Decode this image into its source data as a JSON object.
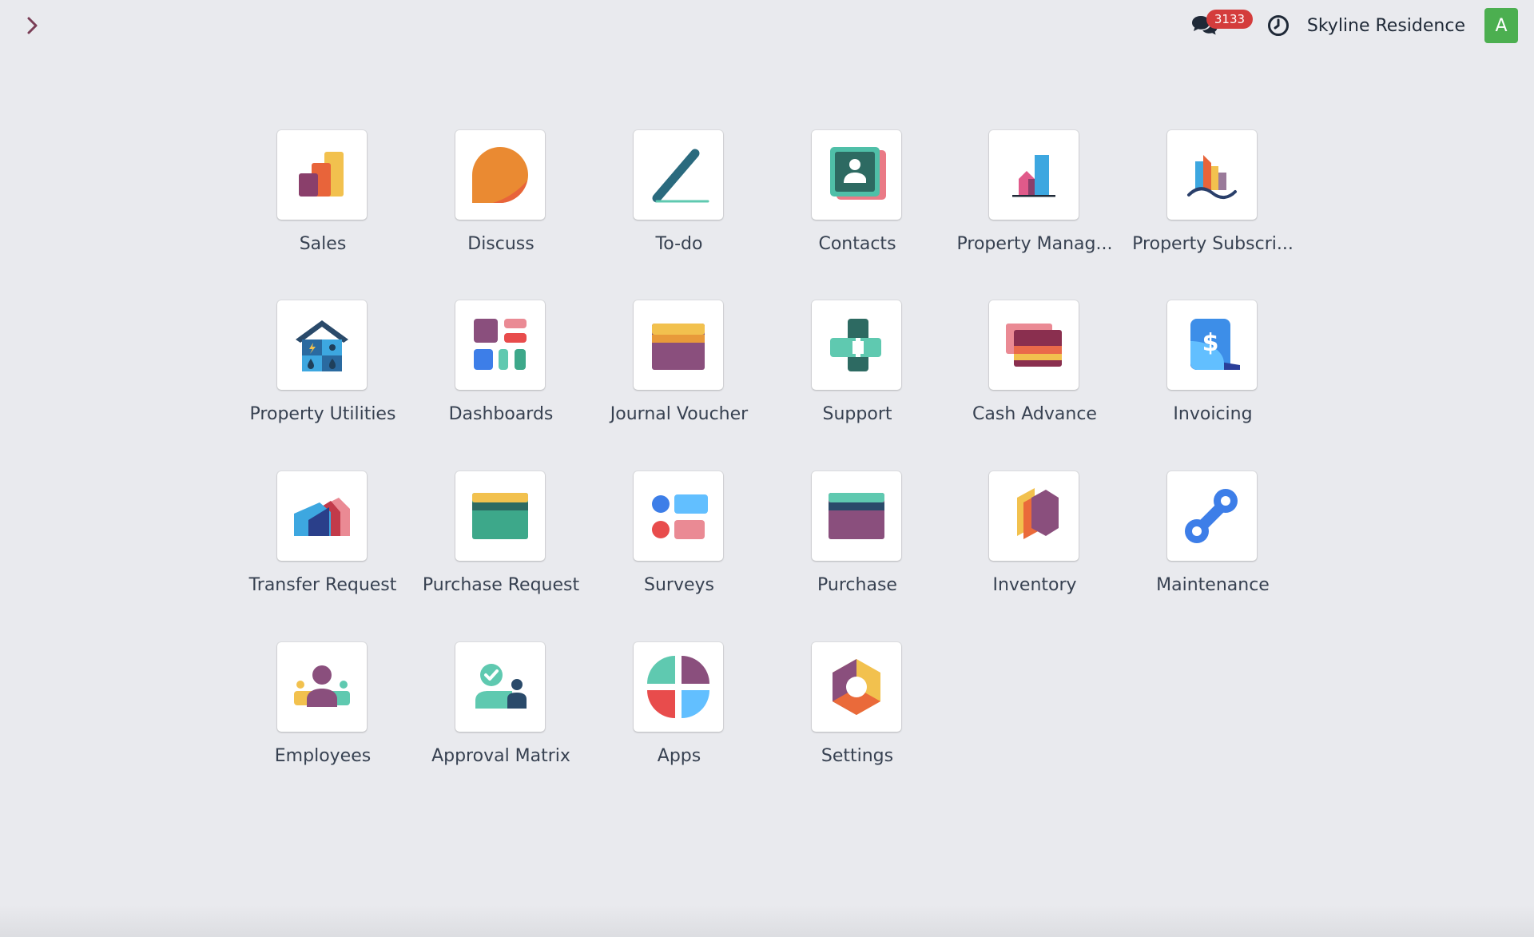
{
  "topbar": {
    "chat_count": "3133",
    "company": "Skyline Residence",
    "avatar_letter": "A"
  },
  "colors": {
    "background": "#e9eaee",
    "badge": "#d43c3c",
    "avatar": "#4caf50",
    "toggle": "#7a3e56"
  },
  "apps": [
    {
      "label": "Sales",
      "icon": "sales-icon"
    },
    {
      "label": "Discuss",
      "icon": "discuss-icon"
    },
    {
      "label": "To-do",
      "icon": "todo-icon"
    },
    {
      "label": "Contacts",
      "icon": "contacts-icon"
    },
    {
      "label": "Property Manag...",
      "icon": "property-management-icon"
    },
    {
      "label": "Property Subscri...",
      "icon": "property-subscription-icon"
    },
    {
      "label": "Property Utilities",
      "icon": "property-utilities-icon"
    },
    {
      "label": "Dashboards",
      "icon": "dashboards-icon"
    },
    {
      "label": "Journal Voucher",
      "icon": "journal-voucher-icon"
    },
    {
      "label": "Support",
      "icon": "support-icon"
    },
    {
      "label": "Cash Advance",
      "icon": "cash-advance-icon"
    },
    {
      "label": "Invoicing",
      "icon": "invoicing-icon"
    },
    {
      "label": "Transfer Request",
      "icon": "transfer-request-icon"
    },
    {
      "label": "Purchase Request",
      "icon": "purchase-request-icon"
    },
    {
      "label": "Surveys",
      "icon": "surveys-icon"
    },
    {
      "label": "Purchase",
      "icon": "purchase-icon"
    },
    {
      "label": "Inventory",
      "icon": "inventory-icon"
    },
    {
      "label": "Maintenance",
      "icon": "maintenance-icon"
    },
    {
      "label": "Employees",
      "icon": "employees-icon"
    },
    {
      "label": "Approval Matrix",
      "icon": "approval-matrix-icon"
    },
    {
      "label": "Apps",
      "icon": "apps-icon"
    },
    {
      "label": "Settings",
      "icon": "settings-icon"
    }
  ]
}
